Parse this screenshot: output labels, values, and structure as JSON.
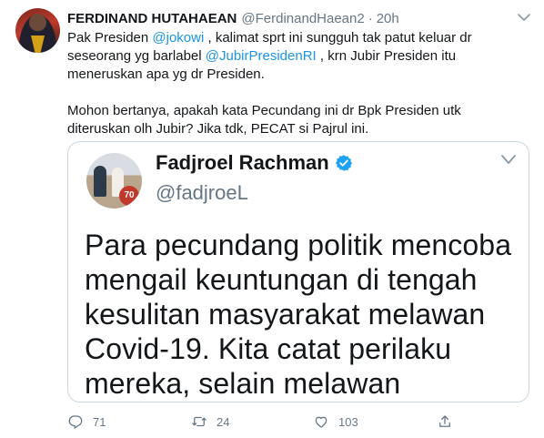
{
  "tweet": {
    "author_name": "FERDINAND HUTAHAEAN",
    "author_handle": "@FerdinandHaean2",
    "separator": "·",
    "time": "20h",
    "paragraph1": {
      "t1": "Pak Presiden ",
      "mention1": "@jokowi",
      "t2": " , kalimat sprt ini sungguh tak patut keluar dr seseorang yg barlabel ",
      "mention2": "@JubirPresidenRI",
      "t3": " , krn Jubir Presiden itu meneruskan apa yg dr Presiden."
    },
    "paragraph2": "Mohon bertanya, apakah kata Pecundang ini dr Bpk Presiden utk diteruskan olh Jubir? Jika tdk, PECAT si Pajrul ini."
  },
  "quoted": {
    "name": "Fadjroel Rachman",
    "handle": "@fadjroeL",
    "avatar_badge": "70",
    "text": "Para pecundang politik mencoba mengail keuntungan di tengah kesulitan masyarakat melawan Covid-19. Kita catat perilaku mereka, selain melawan"
  },
  "actions": {
    "reply_count": "71",
    "retweet_count": "24",
    "like_count": "103"
  },
  "colors": {
    "link": "#1b95e0",
    "muted": "#657786",
    "verified": "#1da1f2",
    "border": "#ccd6dd"
  },
  "icons": [
    "caret-down-icon",
    "verified-badge-icon",
    "chevron-down-icon",
    "reply-icon",
    "retweet-icon",
    "like-icon",
    "share-icon"
  ]
}
